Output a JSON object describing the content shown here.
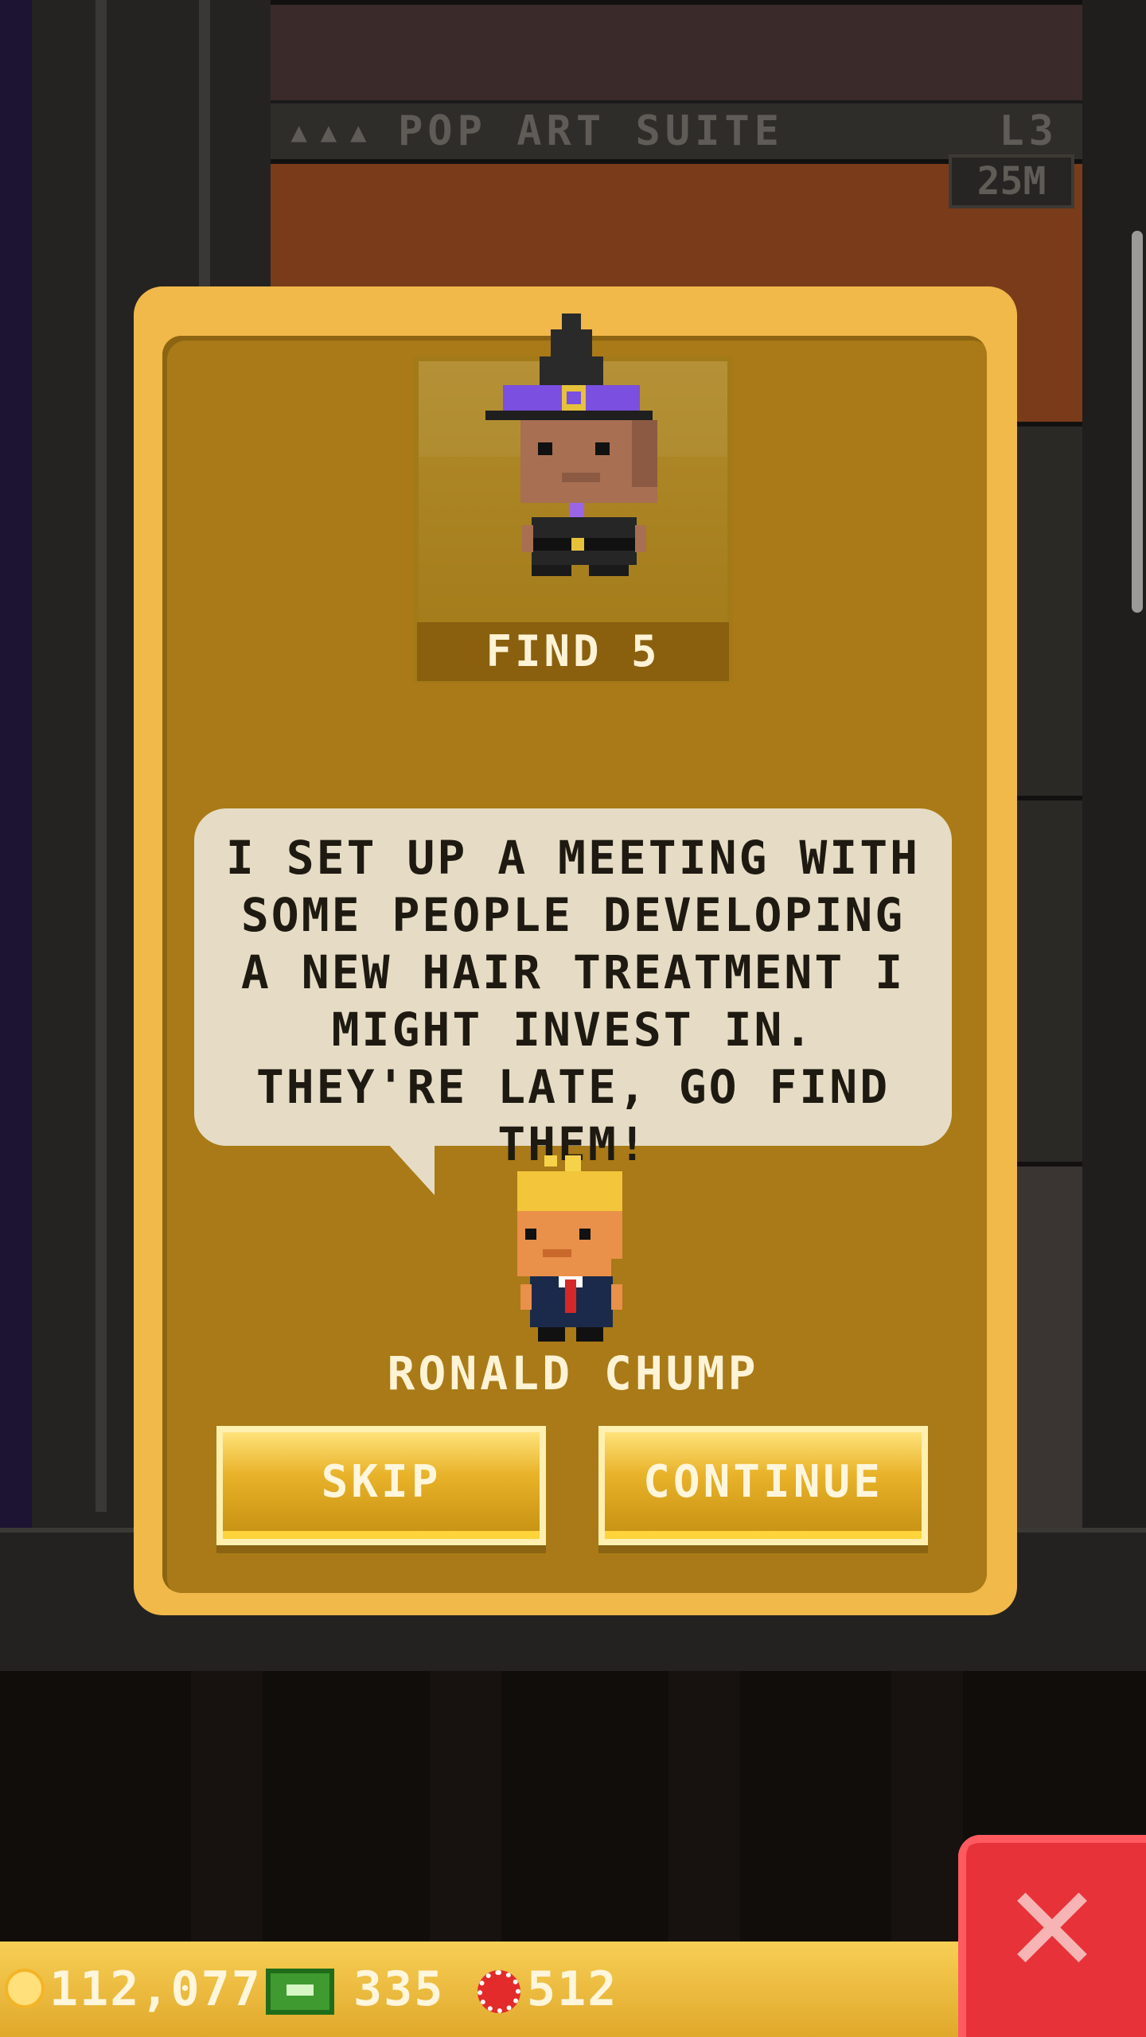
{
  "background": {
    "floor_sign": {
      "dots": "▴▴▴",
      "name": "POP ART SUITE",
      "level": "L3"
    },
    "price_tag": "25M"
  },
  "dialog": {
    "mission": {
      "label": "FIND 5",
      "character_icon": "witch-bitizen-icon"
    },
    "speech": "I SET UP A MEETING WITH SOME PEOPLE DEVELOPING A NEW HAIR TREATMENT I MIGHT INVEST IN. THEY'RE LATE, GO FIND THEM!",
    "speaker": {
      "name": "RONALD CHUMP",
      "avatar_icon": "ronald-chump-avatar-icon"
    },
    "buttons": {
      "skip": "SKIP",
      "continue": "CONTINUE"
    }
  },
  "hud": {
    "coins": "112,077",
    "bux": "335",
    "tokens": "512",
    "close_icon": "close-icon"
  },
  "colors": {
    "dialog_frame": "#f1b84a",
    "dialog_body": "#a97a17",
    "speech_bubble": "#e6dcc5",
    "close_button": "#e8323a",
    "hud_bar": "#f0c04a"
  }
}
